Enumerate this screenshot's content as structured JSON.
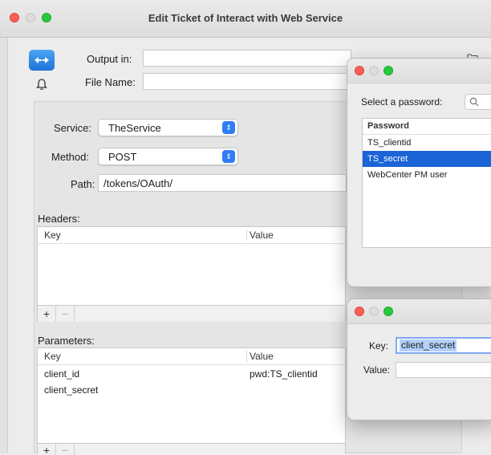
{
  "window": {
    "title": "Edit Ticket of Interact with Web Service"
  },
  "form": {
    "output_in_label": "Output in:",
    "output_in_value": "",
    "file_name_label": "File Name:",
    "file_name_value": "",
    "service_label": "Service:",
    "service_value": "TheService",
    "method_label": "Method:",
    "method_value": "POST",
    "path_label": "Path:",
    "path_value": "/tokens/OAuth/"
  },
  "headers": {
    "label": "Headers:",
    "columns": [
      "Key",
      "Value"
    ],
    "rows": [],
    "add": "+",
    "remove": "−"
  },
  "parameters": {
    "label": "Parameters:",
    "columns": [
      "Key",
      "Value"
    ],
    "rows": [
      {
        "key": "client_id",
        "value": "pwd:TS_clientid"
      },
      {
        "key": "client_secret",
        "value": ""
      }
    ],
    "add": "+",
    "remove": "−"
  },
  "password_dialog": {
    "prompt": "Select a password:",
    "search_placeholder": "",
    "column": "Password",
    "items": [
      "TS_clientid",
      "TS_secret",
      "WebCenter PM user"
    ],
    "selected_index": 1
  },
  "key_dialog": {
    "key_label": "Key:",
    "key_value": "client_secret",
    "value_label": "Value:",
    "value_value": ""
  },
  "colors": {
    "accent": "#2f7cf6",
    "selection": "#1a64d6"
  }
}
